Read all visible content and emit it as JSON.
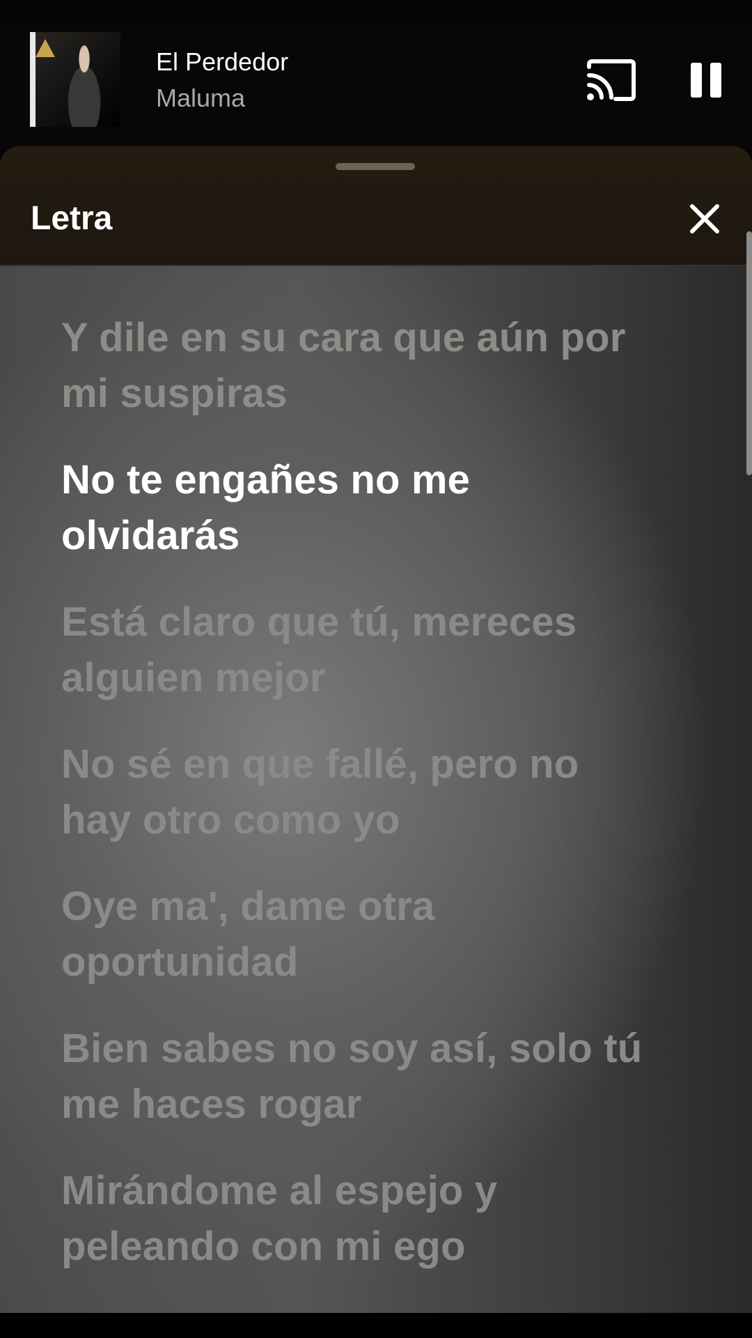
{
  "mini_player": {
    "title": "El Perdedor",
    "artist": "Maluma",
    "cast_icon": "cast-icon",
    "pause_icon": "pause-icon"
  },
  "lyrics_sheet": {
    "title": "Letra",
    "close_icon": "close-icon",
    "lines": [
      {
        "line1": "Y dile en su cara que aún por",
        "line2": "mi suspiras",
        "state": "faded"
      },
      {
        "line1": "No te engañes no me",
        "line2": "olvidarás",
        "state": "active"
      },
      {
        "line1": "Está claro que tú, mereces",
        "line2": "alguien mejor",
        "state": "upcoming"
      },
      {
        "line1": "No sé en que fallé, pero no",
        "line2": "hay otro como yo",
        "state": "upcoming"
      },
      {
        "line1": "Oye ma', dame otra",
        "line2": "oportunidad",
        "state": "upcoming"
      },
      {
        "line1": "Bien sabes no soy así, solo tú",
        "line2": "me haces rogar",
        "state": "upcoming"
      },
      {
        "line1": "Mirándome al espejo y",
        "line2": "peleando con mi ego",
        "state": "upcoming"
      }
    ]
  },
  "colors": {
    "active_lyric": "#ffffff",
    "inactive_lyric": "#8a8a8a",
    "header_bg": "#241c10"
  }
}
